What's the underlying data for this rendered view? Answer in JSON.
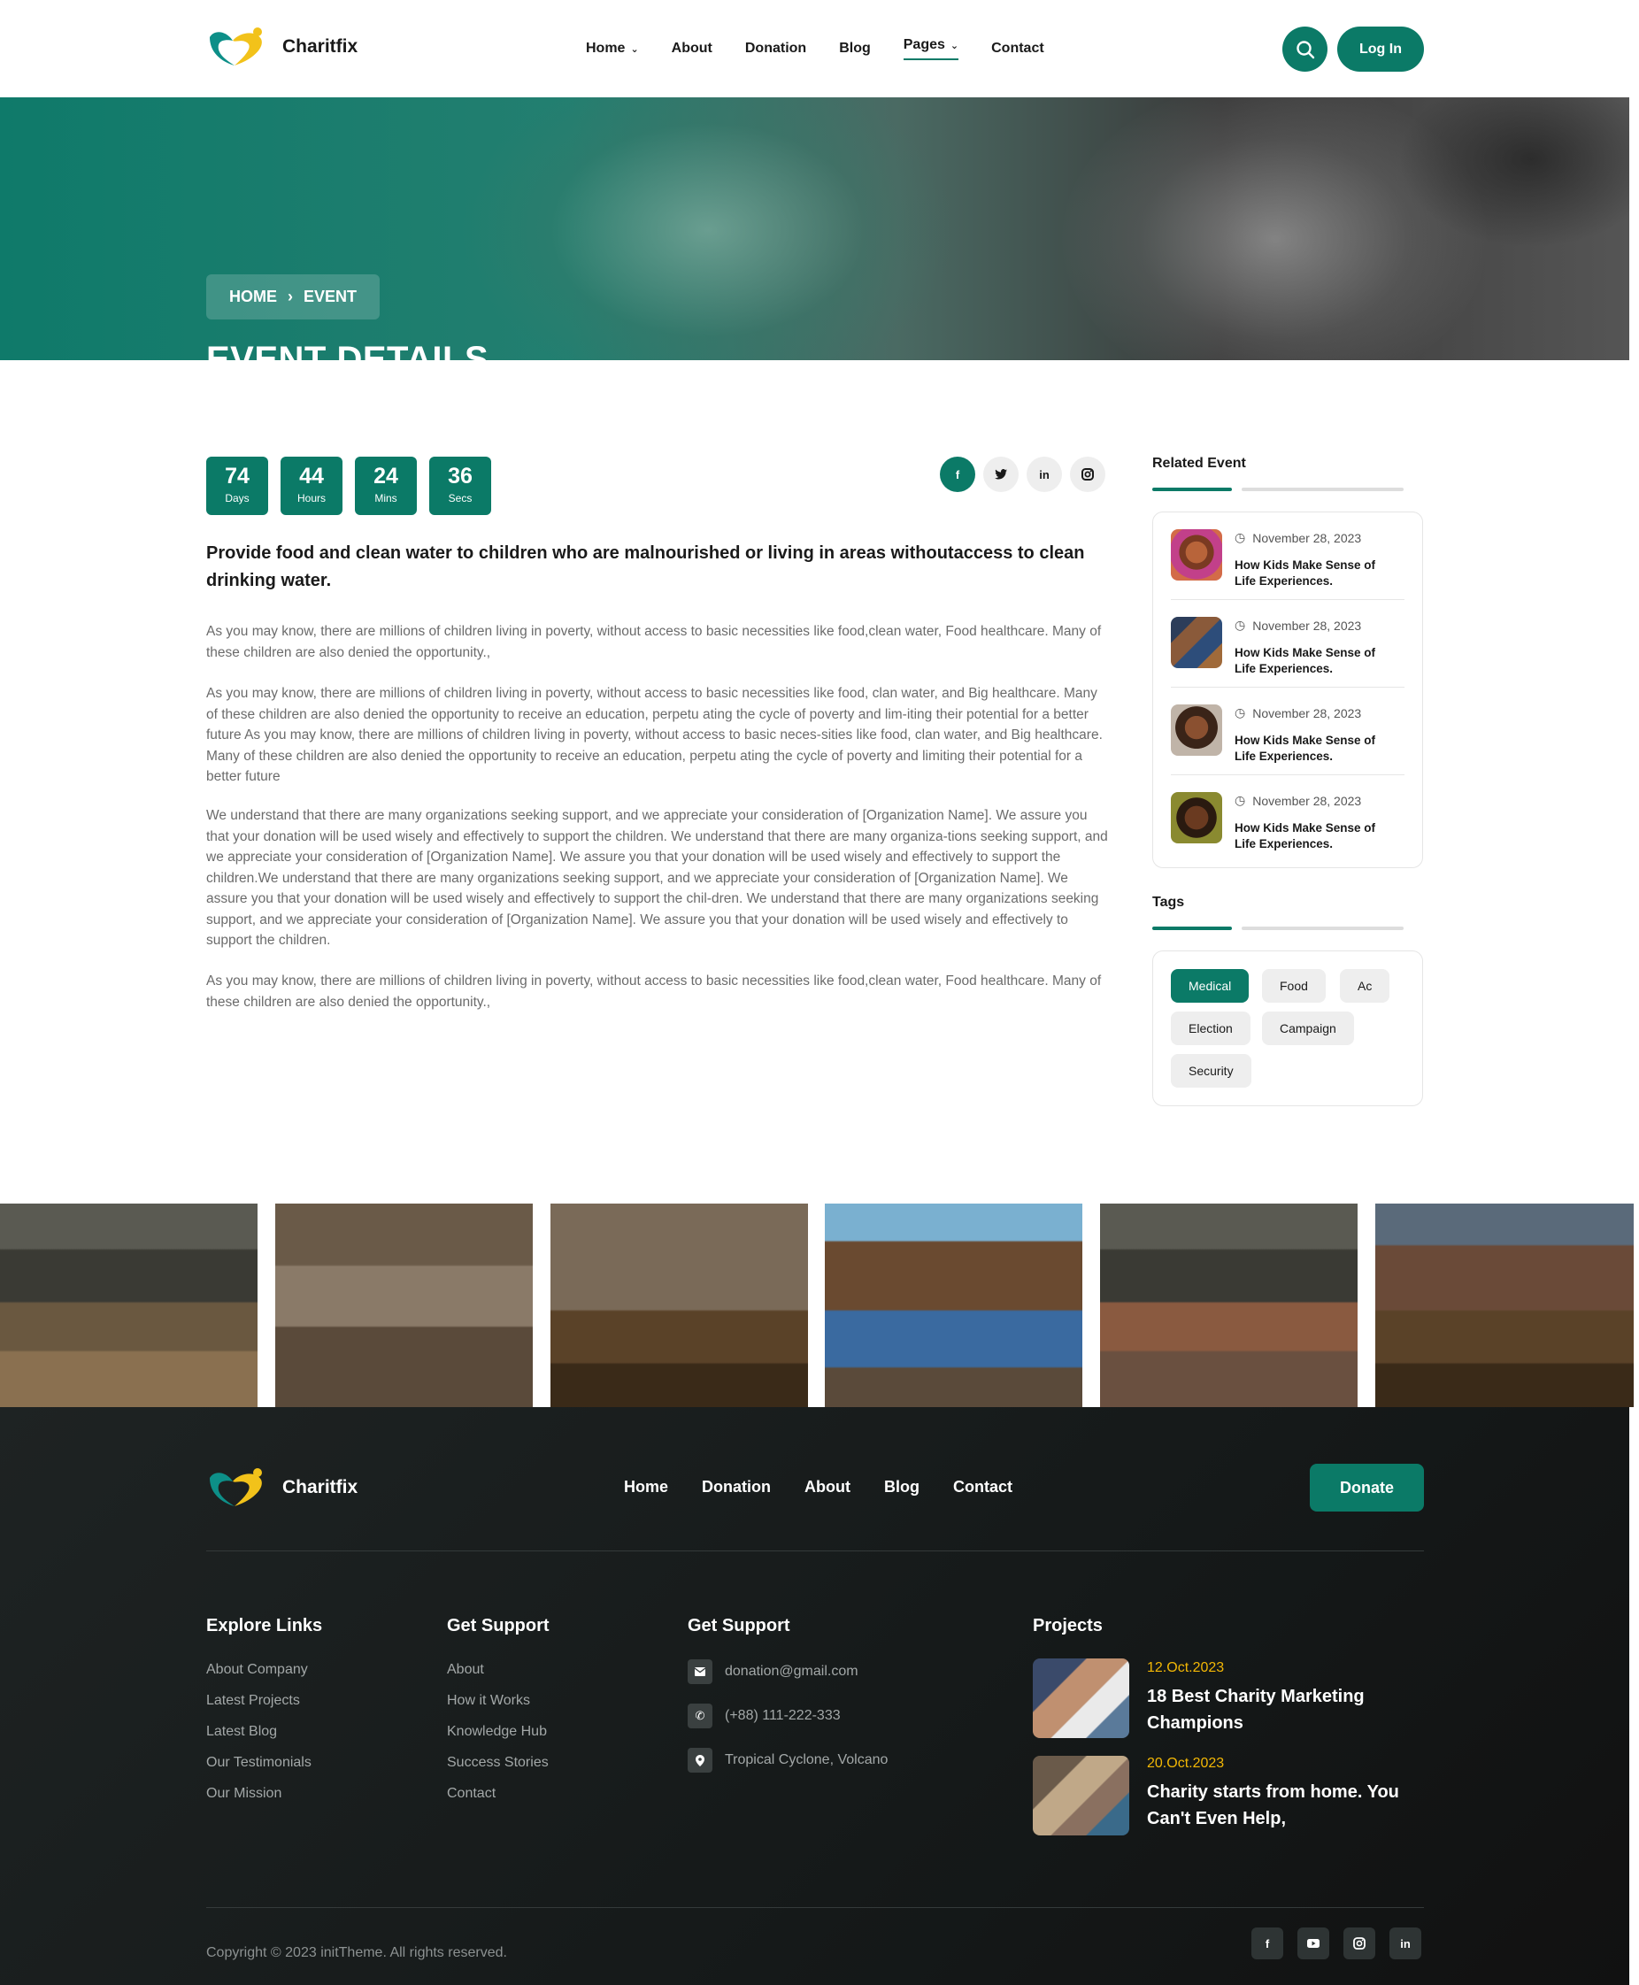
{
  "brand": {
    "name": "Charitfix"
  },
  "nav": {
    "items": [
      "Home",
      "About",
      "Donation",
      "Blog",
      "Pages",
      "Contact"
    ],
    "login_label": "Log In"
  },
  "hero": {
    "breadcrumb_home": "HOME",
    "breadcrumb_sep": "›",
    "breadcrumb_current": "EVENT",
    "title": "EVENT DETAILS"
  },
  "countdown": [
    {
      "value": "74",
      "label": "Days"
    },
    {
      "value": "44",
      "label": "Hours"
    },
    {
      "value": "24",
      "label": "Mins"
    },
    {
      "value": "36",
      "label": "Secs"
    }
  ],
  "share_icons": [
    "facebook-icon",
    "twitter-icon",
    "linkedin-icon",
    "instagram-icon"
  ],
  "article": {
    "lead": "Provide food and clean water to children who are malnourished or living in areas withoutaccess to clean drinking water.",
    "paragraphs": [
      "As you may know, there are millions of children living in poverty, without access to basic necessities like food,clean water, Food healthcare. Many of these children are also denied the opportunity.,",
      "As you may know, there are millions of children living in poverty, without access to basic necessities like food, clan water, and Big healthcare. Many of these children are also denied the opportunity to receive an education, perpetu ating the cycle of poverty and lim-iting their potential for a better future As you may know, there are millions of children living in poverty, without access to basic neces-sities like food, clan water, and Big healthcare. Many of these children are also denied the opportunity to receive an education, perpetu ating the cycle of poverty and limiting their potential for a better future",
      "We understand that there are many organizations seeking support, and we appreciate your consideration of [Organization Name]. We assure you that your donation will be used wisely and effectively to support the children. We understand that there are many organiza-tions seeking support, and we appreciate your consideration of [Organization Name]. We assure you that your donation will be used wisely and effectively to support the children.We understand that there are many organizations seeking support, and we appreciate your consideration of [Organization Name]. We assure you that your donation will be used wisely and effectively to support the chil-dren. We understand that there are many organizations seeking support, and we appreciate your consideration of [Organization Name]. We assure you that your donation will be used wisely and effectively to support the children.",
      "As you may know, there are millions of children living in poverty, without access to basic necessities like food,clean water, Food healthcare. Many of these children are also denied the opportunity.,"
    ]
  },
  "sidebar": {
    "related_heading": "Related Event",
    "related": [
      {
        "date": "November 28, 2023",
        "title": "How Kids Make Sense of Life Experiences."
      },
      {
        "date": "November 28, 2023",
        "title": "How Kids Make Sense of Life Experiences."
      },
      {
        "date": "November 28, 2023",
        "title": "How Kids Make Sense of Life Experiences."
      },
      {
        "date": "November 28, 2023",
        "title": "How Kids Make Sense of Life Experiences."
      }
    ],
    "tags_heading": "Tags",
    "tags": [
      "Medical",
      "Food",
      "Ac",
      "Election",
      "Campaign",
      "Security"
    ]
  },
  "footer": {
    "brand": "Charitfix",
    "nav": [
      "Home",
      "Donation",
      "About",
      "Blog",
      "Contact"
    ],
    "donate_label": "Donate",
    "explore_heading": "Explore Links",
    "explore_links": [
      "About Company",
      "Latest Projects",
      "Latest Blog",
      "Our Testimonials",
      "Our Mission"
    ],
    "support_heading": "Get Support",
    "support_links": [
      "About",
      "How it Works",
      "Knowledge Hub",
      "Success Stories",
      "Contact"
    ],
    "contact_heading": "Get Support",
    "contact": {
      "email": "donation@gmail.com",
      "phone": "(+88) 111-222-333",
      "address": "Tropical Cyclone, Volcano"
    },
    "projects_heading": "Projects",
    "projects": [
      {
        "date": "12.Oct.2023",
        "title": "18 Best Charity Marketing Champions"
      },
      {
        "date": "20.Oct.2023",
        "title": "Charity starts from home. You Can't Even Help,"
      }
    ],
    "copyright": "Copyright © 2023 initTheme. All rights reserved.",
    "social": [
      "facebook-icon",
      "youtube-icon",
      "instagram-icon",
      "linkedin-icon"
    ]
  },
  "colors": {
    "accent": "#0b7a67",
    "footer_bg": "#1a1f1f",
    "project_date": "#f2b705"
  }
}
